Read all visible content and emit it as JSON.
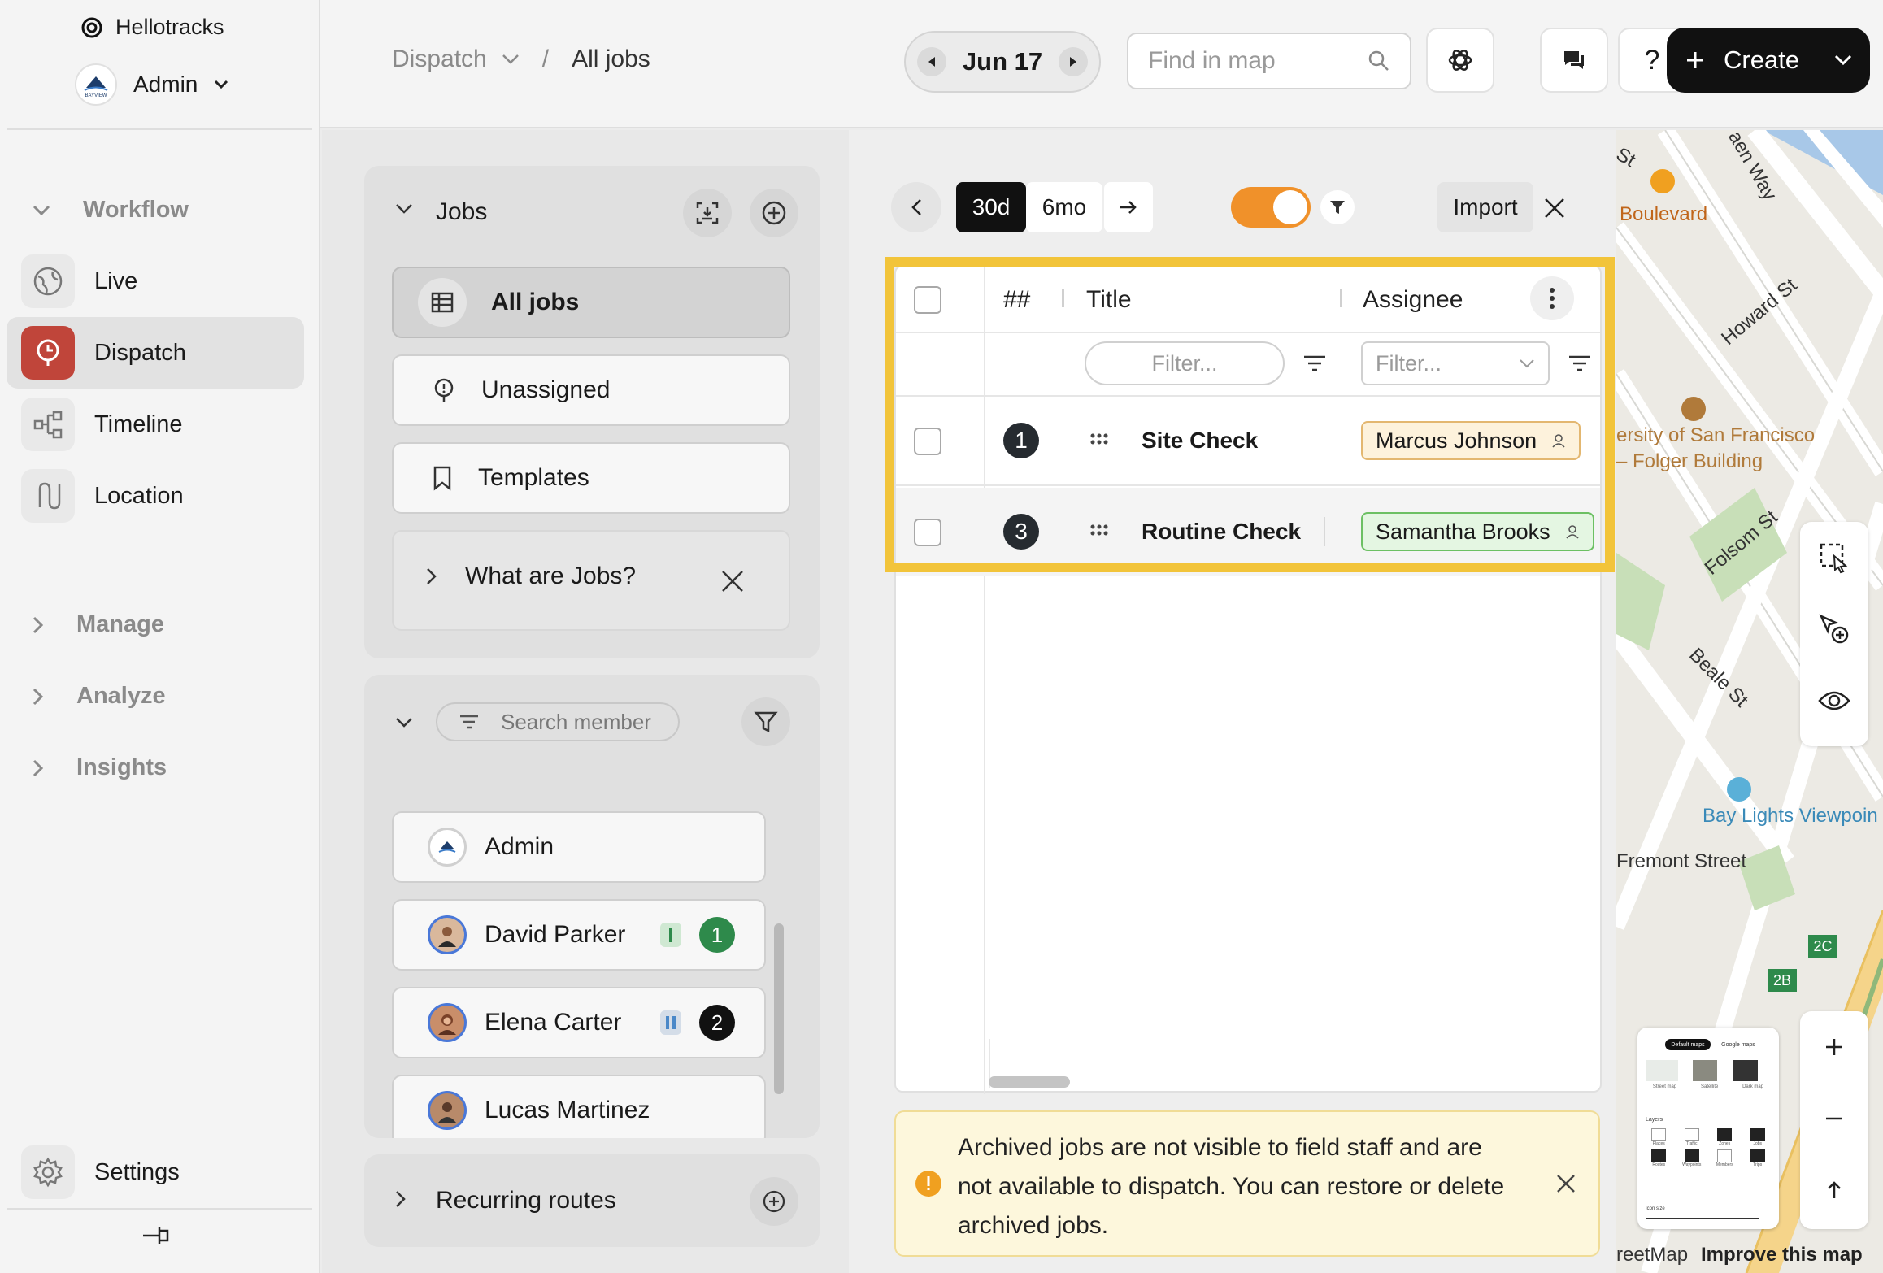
{
  "app": {
    "name": "Hellotracks",
    "account": "Admin",
    "account_logo_text": "BAYVIEW"
  },
  "sidebar": {
    "workflow_label": "Workflow",
    "items": [
      {
        "label": "Live",
        "icon": "globe-icon"
      },
      {
        "label": "Dispatch",
        "icon": "dispatch-icon",
        "active": true
      },
      {
        "label": "Timeline",
        "icon": "timeline-icon"
      },
      {
        "label": "Location",
        "icon": "route-icon"
      }
    ],
    "groups": [
      "Manage",
      "Analyze",
      "Insights"
    ],
    "settings_label": "Settings"
  },
  "header": {
    "breadcrumb_parent": "Dispatch",
    "breadcrumb_sep": "/",
    "breadcrumb_current": "All jobs",
    "date": "Jun 17",
    "find_placeholder": "Find in map",
    "help_label": "?",
    "create_label": "Create"
  },
  "jobs_panel": {
    "title": "Jobs",
    "items": [
      {
        "label": "All jobs",
        "selected": true
      },
      {
        "label": "Unassigned"
      },
      {
        "label": "Templates"
      }
    ],
    "info_label": "What are Jobs?"
  },
  "members_panel": {
    "search_placeholder": "Search member",
    "members": [
      {
        "name": "Admin"
      },
      {
        "name": "David Parker",
        "count": "1",
        "count_color": "#2e8a4b"
      },
      {
        "name": "Elena Carter",
        "count": "2",
        "count_color": "#111111"
      },
      {
        "name": "Lucas Martinez"
      }
    ]
  },
  "routes_panel": {
    "title": "Recurring routes"
  },
  "toolbar": {
    "range_30d": "30d",
    "range_6mo": "6mo",
    "toggle_on": true,
    "import_label": "Import"
  },
  "table": {
    "columns": {
      "number": "##",
      "title": "Title",
      "assignee": "Assignee"
    },
    "filter_placeholder": "Filter...",
    "rows": [
      {
        "number": "1",
        "title": "Site Check",
        "assignee": "Marcus Johnson",
        "assignee_bg": "#fdf2dc",
        "assignee_border": "#e3b770"
      },
      {
        "number": "3",
        "title": "Routine Check",
        "assignee": "Samantha Brooks",
        "assignee_bg": "#e4f6e2",
        "assignee_border": "#6cc063"
      }
    ]
  },
  "notice": {
    "text_line1": "Archived jobs are not visible to field staff and are",
    "text_line2": "not available to dispatch. You can restore or delete",
    "text_line3": "archived jobs."
  },
  "map": {
    "labels": {
      "boulevard": "Boulevard",
      "howard": "Howard St",
      "university1": "ersity of San Francisco",
      "university2": "– Folger Building",
      "folsom": "Folsom St",
      "beale": "Beale St",
      "bay_lights": "Bay Lights Viewpoin",
      "fremont": "Fremont Street",
      "way": "aen Way",
      "st": "St",
      "hwy_2c": "2C",
      "hwy_2b": "2B",
      "attribution": "reetMap",
      "improve": "Improve this map"
    },
    "thumbnail": {
      "tab_default": "Default maps",
      "tab_google": "Google maps",
      "view_labels": [
        "Street map",
        "Satellite",
        "Dark map"
      ],
      "layers_label": "Layers",
      "layer_labels": [
        "Places",
        "Traffic",
        "Zones",
        "Jobs",
        "Routes",
        "Waypoints",
        "Members",
        "Trips"
      ],
      "icon_size_label": "Icon size"
    }
  }
}
